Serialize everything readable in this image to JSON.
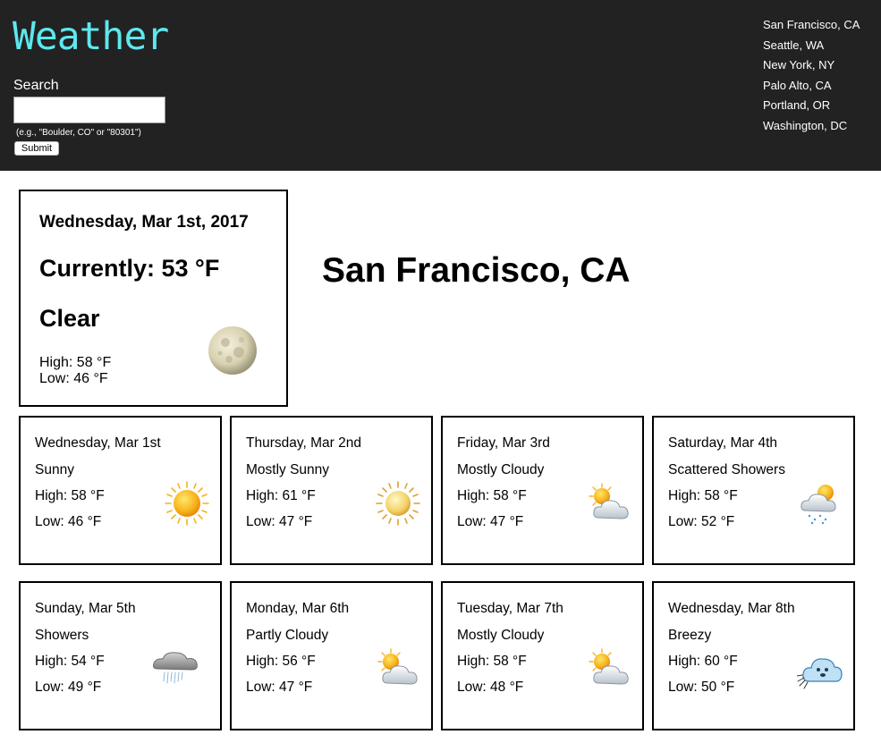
{
  "header": {
    "logo": "Weather",
    "search_label": "Search",
    "search_value": "",
    "search_hint": "(e.g., \"Boulder, CO\" or \"80301\")",
    "submit_label": "Submit",
    "cities": [
      "San Francisco, CA",
      "Seattle, WA",
      "New York, NY",
      "Palo Alto, CA",
      "Portland, OR",
      "Washington, DC"
    ]
  },
  "current": {
    "date": "Wednesday, Mar 1st, 2017",
    "temp": "Currently: 53 °F",
    "condition": "Clear",
    "high": "High: 58 °F",
    "low": "Low: 46 °F",
    "icon": "moon-icon"
  },
  "location": "San Francisco, CA",
  "forecast": [
    {
      "day": "Wednesday, Mar 1st",
      "condition": "Sunny",
      "high": "High: 58 °F",
      "low": "Low: 46 °F",
      "icon": "sun-icon"
    },
    {
      "day": "Thursday, Mar 2nd",
      "condition": "Mostly Sunny",
      "high": "High: 61 °F",
      "low": "Low: 47 °F",
      "icon": "sun-icon"
    },
    {
      "day": "Friday, Mar 3rd",
      "condition": "Mostly Cloudy",
      "high": "High: 58 °F",
      "low": "Low: 47 °F",
      "icon": "partly-cloudy-icon"
    },
    {
      "day": "Saturday, Mar 4th",
      "condition": "Scattered Showers",
      "high": "High: 58 °F",
      "low": "Low: 52 °F",
      "icon": "sun-shower-icon"
    },
    {
      "day": "Sunday, Mar 5th",
      "condition": "Showers",
      "high": "High: 54 °F",
      "low": "Low: 49 °F",
      "icon": "rain-cloud-icon"
    },
    {
      "day": "Monday, Mar 6th",
      "condition": "Partly Cloudy",
      "high": "High: 56 °F",
      "low": "Low: 47 °F",
      "icon": "partly-cloudy-icon"
    },
    {
      "day": "Tuesday, Mar 7th",
      "condition": "Mostly Cloudy",
      "high": "High: 58 °F",
      "low": "Low: 48 °F",
      "icon": "partly-cloudy-icon"
    },
    {
      "day": "Wednesday, Mar 8th",
      "condition": "Breezy",
      "high": "High: 60 °F",
      "low": "Low: 50 °F",
      "icon": "wind-cloud-icon"
    }
  ],
  "colors": {
    "header_bg": "#222222",
    "logo": "#5de8ee",
    "text_light": "#ffffff",
    "border": "#000000"
  }
}
